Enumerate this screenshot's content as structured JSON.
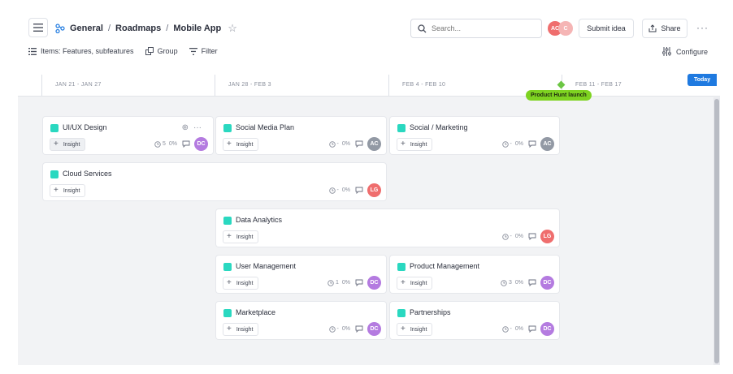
{
  "header": {
    "breadcrumb": [
      "General",
      "Roadmaps",
      "Mobile App"
    ],
    "search_placeholder": "Search...",
    "avatars": [
      {
        "initials": "AC",
        "color": "#ef6e6e"
      },
      {
        "initials": "C",
        "color": "#f5b5b5"
      }
    ],
    "submit_label": "Submit idea",
    "share_label": "Share"
  },
  "toolbar": {
    "items_label": "Items: Features, subfeatures",
    "group_label": "Group",
    "filter_label": "Filter",
    "configure_label": "Configure"
  },
  "timeline": {
    "columns": [
      "JAN 21 - JAN 27",
      "JAN 28 - FEB 3",
      "FEB 4 - FEB 10",
      "FEB 11 - FEB 17"
    ],
    "today_label": "Today",
    "milestone": "Product Hunt launch"
  },
  "colors": {
    "accent": "#1f7ae0",
    "feature_square": "#2ad8c0",
    "milestone": "#7ed321",
    "avatar_DC": "#b47be0",
    "avatar_AC": "#9299a4",
    "avatar_LG": "#ef6e6e"
  },
  "insight_label": "Insight",
  "cards": [
    {
      "title": "UI/UX Design",
      "count": "5",
      "pct": "0%",
      "avatar": "DC",
      "avatar_color": "#b47be0"
    },
    {
      "title": "Social Media Plan",
      "count": "-",
      "pct": "0%",
      "avatar": "AC",
      "avatar_color": "#9299a4"
    },
    {
      "title": "Social / Marketing",
      "count": "-",
      "pct": "0%",
      "avatar": "AC",
      "avatar_color": "#9299a4"
    },
    {
      "title": "Cloud Services",
      "count": "-",
      "pct": "0%",
      "avatar": "LG",
      "avatar_color": "#ef6e6e"
    },
    {
      "title": "Data Analytics",
      "count": "-",
      "pct": "0%",
      "avatar": "LG",
      "avatar_color": "#ef6e6e"
    },
    {
      "title": "User Management",
      "count": "1",
      "pct": "0%",
      "avatar": "DC",
      "avatar_color": "#b47be0"
    },
    {
      "title": "Product Management",
      "count": "3",
      "pct": "0%",
      "avatar": "DC",
      "avatar_color": "#b47be0"
    },
    {
      "title": "Marketplace",
      "count": "-",
      "pct": "0%",
      "avatar": "DC",
      "avatar_color": "#b47be0"
    },
    {
      "title": "Partnerships",
      "count": "-",
      "pct": "0%",
      "avatar": "DC",
      "avatar_color": "#b47be0"
    }
  ]
}
